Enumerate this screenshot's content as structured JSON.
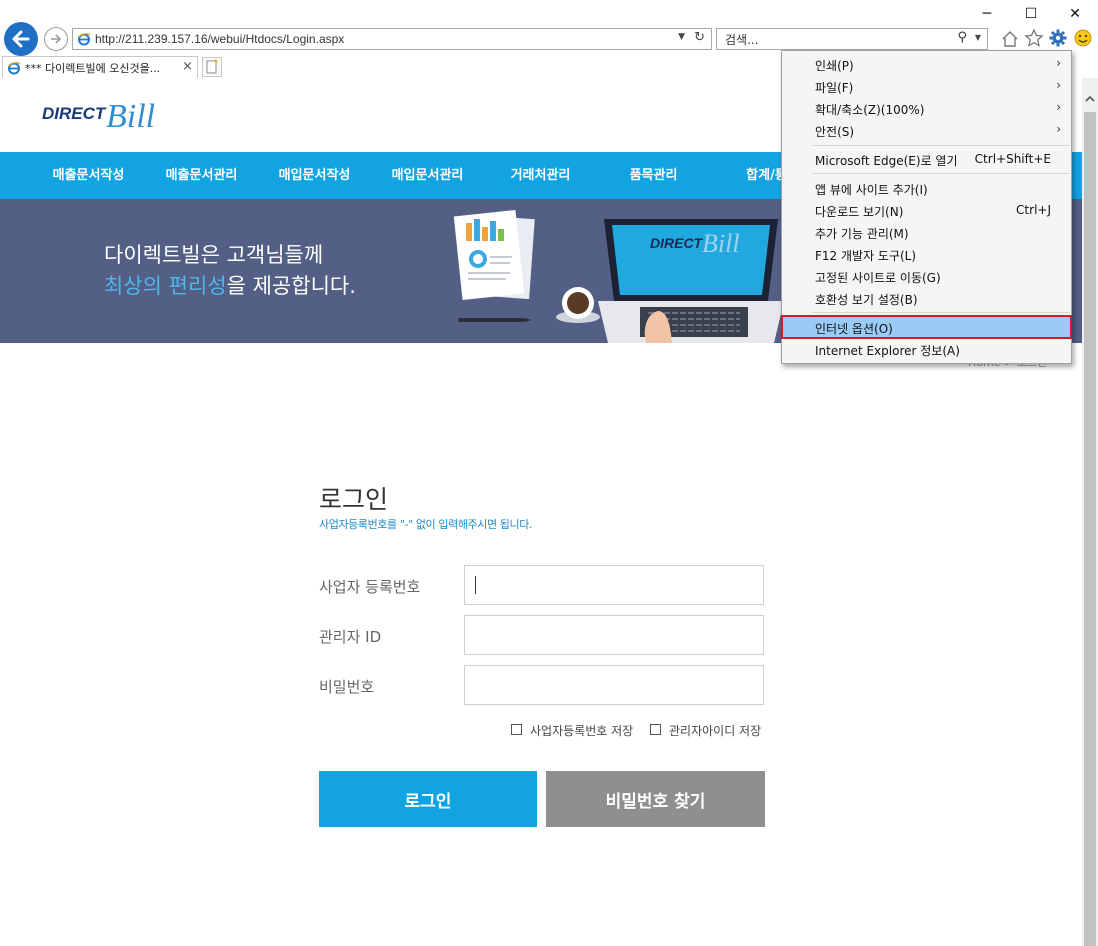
{
  "browser": {
    "window_controls": {
      "minimize": "─",
      "maximize": "☐",
      "close": "✕"
    },
    "address_url": "http://211.239.157.16/webui/Htdocs/Login.aspx",
    "search_placeholder": "검색...",
    "tab_title": "*** 다이렉트빌에 오신것을...",
    "tab_close": "×"
  },
  "menu": {
    "items": [
      {
        "label": "인쇄(P)",
        "shortcut": "",
        "submenu": true
      },
      {
        "label": "파일(F)",
        "shortcut": "",
        "submenu": true
      },
      {
        "label": "확대/축소(Z)(100%)",
        "shortcut": "",
        "submenu": true
      },
      {
        "label": "안전(S)",
        "shortcut": "",
        "submenu": true
      },
      {
        "label": "Microsoft Edge(E)로 열기",
        "shortcut": "Ctrl+Shift+E",
        "submenu": false
      },
      {
        "label": "앱 뷰에 사이트 추가(I)",
        "shortcut": "",
        "submenu": false
      },
      {
        "label": "다운로드 보기(N)",
        "shortcut": "Ctrl+J",
        "submenu": false
      },
      {
        "label": "추가 기능 관리(M)",
        "shortcut": "",
        "submenu": false
      },
      {
        "label": "F12 개발자 도구(L)",
        "shortcut": "",
        "submenu": false
      },
      {
        "label": "고정된 사이트로 이동(G)",
        "shortcut": "",
        "submenu": false
      },
      {
        "label": "호환성 보기 설정(B)",
        "shortcut": "",
        "submenu": false
      },
      {
        "label": "인터넷 옵션(O)",
        "shortcut": "",
        "submenu": false,
        "highlighted": true
      },
      {
        "label": "Internet Explorer 정보(A)",
        "shortcut": "",
        "submenu": false
      }
    ],
    "arrow": "›"
  },
  "site": {
    "logo_direct": "DIRECT",
    "logo_bill": "Bill",
    "nav": [
      "매출문서작성",
      "매출문서관리",
      "매입문서작성",
      "매입문서관리",
      "거래처관리",
      "품목관리",
      "합계/통"
    ],
    "banner_line1": "다이렉트빌은 고객님들께",
    "banner_line2_highlight": "최상의 편리성",
    "banner_line2_rest": "을 제공합니다.",
    "banner_laptop_logo_direct": "DIRECT",
    "banner_laptop_logo_bill": "Bill",
    "breadcrumb_partial": "Home > 로그인"
  },
  "login": {
    "title": "로그인",
    "subtitle": "사업자등록번호를 \"-\" 없이 입력해주시면 됩니다.",
    "fields": [
      {
        "label": "사업자 등록번호",
        "value": ""
      },
      {
        "label": "관리자 ID",
        "value": ""
      },
      {
        "label": "비밀번호",
        "value": ""
      }
    ],
    "save_bizno": "사업자등록번호 저장",
    "save_adminid": "관리자아이디 저장",
    "login_button": "로그인",
    "find_password_button": "비밀번호 찾기"
  },
  "colors": {
    "nav_bg": "#12a3e2",
    "banner_bg": "#535f85",
    "accent_text": "#4fb6ec",
    "login_button": "#12a3e2",
    "find_button": "#8f8f8f",
    "menu_highlight": "#99cbf6",
    "highlight_outline": "#d11a2a"
  }
}
